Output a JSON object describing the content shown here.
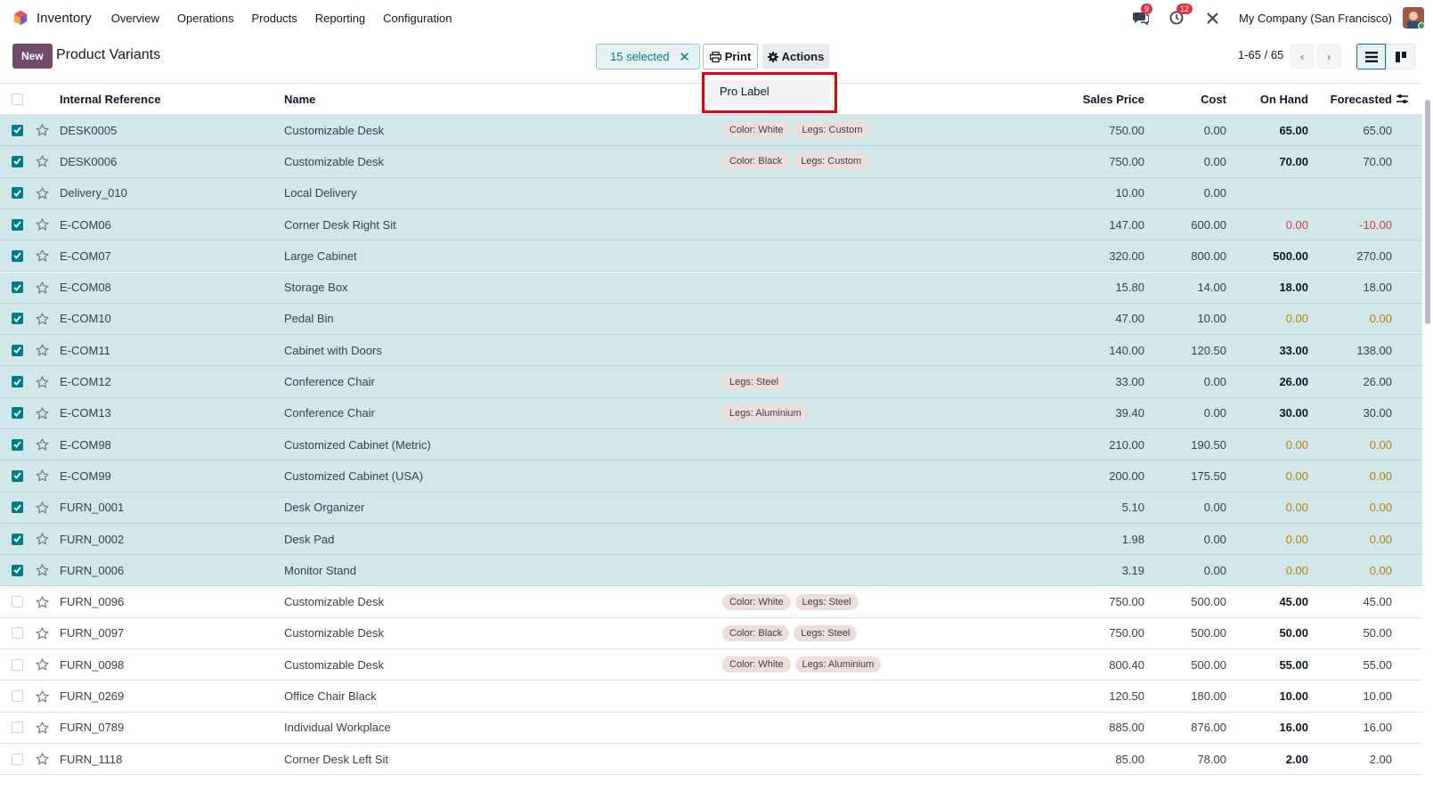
{
  "nav": {
    "app_name": "Inventory",
    "menu": [
      "Overview",
      "Operations",
      "Products",
      "Reporting",
      "Configuration"
    ],
    "messages_badge": "9",
    "activity_badge": "12",
    "company": "My Company (San Francisco)"
  },
  "control": {
    "new_label": "New",
    "title": "Product Variants",
    "selected_label": "15 selected",
    "print_label": "Print",
    "actions_label": "Actions",
    "pager": "1-65 / 65"
  },
  "dropdown": {
    "items": [
      "Pro Label"
    ]
  },
  "table": {
    "headers": {
      "reference": "Internal Reference",
      "name": "Name",
      "price": "Sales Price",
      "cost": "Cost",
      "on_hand": "On Hand",
      "forecasted": "Forecasted"
    },
    "rows": [
      {
        "ref": "DESK0005",
        "name": "Customizable Desk",
        "tags": [
          "Color: White",
          "Legs: Custom"
        ],
        "price": "750.00",
        "cost": "0.00",
        "on_hand": "65.00",
        "forecasted": "65.00",
        "selected": true,
        "status": "normal"
      },
      {
        "ref": "DESK0006",
        "name": "Customizable Desk",
        "tags": [
          "Color: Black",
          "Legs: Custom"
        ],
        "price": "750.00",
        "cost": "0.00",
        "on_hand": "70.00",
        "forecasted": "70.00",
        "selected": true,
        "status": "normal"
      },
      {
        "ref": "Delivery_010",
        "name": "Local Delivery",
        "tags": [],
        "price": "10.00",
        "cost": "0.00",
        "on_hand": "",
        "forecasted": "",
        "selected": true,
        "status": "normal"
      },
      {
        "ref": "E-COM06",
        "name": "Corner Desk Right Sit",
        "tags": [],
        "price": "147.00",
        "cost": "600.00",
        "on_hand": "0.00",
        "forecasted": "-10.00",
        "selected": true,
        "status": "negative"
      },
      {
        "ref": "E-COM07",
        "name": "Large Cabinet",
        "tags": [],
        "price": "320.00",
        "cost": "800.00",
        "on_hand": "500.00",
        "forecasted": "270.00",
        "selected": true,
        "status": "normal"
      },
      {
        "ref": "E-COM08",
        "name": "Storage Box",
        "tags": [],
        "price": "15.80",
        "cost": "14.00",
        "on_hand": "18.00",
        "forecasted": "18.00",
        "selected": true,
        "status": "normal"
      },
      {
        "ref": "E-COM10",
        "name": "Pedal Bin",
        "tags": [],
        "price": "47.00",
        "cost": "10.00",
        "on_hand": "0.00",
        "forecasted": "0.00",
        "selected": true,
        "status": "zero"
      },
      {
        "ref": "E-COM11",
        "name": "Cabinet with Doors",
        "tags": [],
        "price": "140.00",
        "cost": "120.50",
        "on_hand": "33.00",
        "forecasted": "138.00",
        "selected": true,
        "status": "normal"
      },
      {
        "ref": "E-COM12",
        "name": "Conference Chair",
        "tags": [
          "Legs: Steel"
        ],
        "price": "33.00",
        "cost": "0.00",
        "on_hand": "26.00",
        "forecasted": "26.00",
        "selected": true,
        "status": "normal"
      },
      {
        "ref": "E-COM13",
        "name": "Conference Chair",
        "tags": [
          "Legs: Aluminium"
        ],
        "price": "39.40",
        "cost": "0.00",
        "on_hand": "30.00",
        "forecasted": "30.00",
        "selected": true,
        "status": "normal"
      },
      {
        "ref": "E-COM98",
        "name": "Customized Cabinet (Metric)",
        "tags": [],
        "price": "210.00",
        "cost": "190.50",
        "on_hand": "0.00",
        "forecasted": "0.00",
        "selected": true,
        "status": "zero"
      },
      {
        "ref": "E-COM99",
        "name": "Customized Cabinet (USA)",
        "tags": [],
        "price": "200.00",
        "cost": "175.50",
        "on_hand": "0.00",
        "forecasted": "0.00",
        "selected": true,
        "status": "zero"
      },
      {
        "ref": "FURN_0001",
        "name": "Desk Organizer",
        "tags": [],
        "price": "5.10",
        "cost": "0.00",
        "on_hand": "0.00",
        "forecasted": "0.00",
        "selected": true,
        "status": "zero"
      },
      {
        "ref": "FURN_0002",
        "name": "Desk Pad",
        "tags": [],
        "price": "1.98",
        "cost": "0.00",
        "on_hand": "0.00",
        "forecasted": "0.00",
        "selected": true,
        "status": "zero"
      },
      {
        "ref": "FURN_0006",
        "name": "Monitor Stand",
        "tags": [],
        "price": "3.19",
        "cost": "0.00",
        "on_hand": "0.00",
        "forecasted": "0.00",
        "selected": true,
        "status": "zero"
      },
      {
        "ref": "FURN_0096",
        "name": "Customizable Desk",
        "tags": [
          "Color: White",
          "Legs: Steel"
        ],
        "price": "750.00",
        "cost": "500.00",
        "on_hand": "45.00",
        "forecasted": "45.00",
        "selected": false,
        "status": "normal"
      },
      {
        "ref": "FURN_0097",
        "name": "Customizable Desk",
        "tags": [
          "Color: Black",
          "Legs: Steel"
        ],
        "price": "750.00",
        "cost": "500.00",
        "on_hand": "50.00",
        "forecasted": "50.00",
        "selected": false,
        "status": "normal"
      },
      {
        "ref": "FURN_0098",
        "name": "Customizable Desk",
        "tags": [
          "Color: White",
          "Legs: Aluminium"
        ],
        "price": "800.40",
        "cost": "500.00",
        "on_hand": "55.00",
        "forecasted": "55.00",
        "selected": false,
        "status": "normal"
      },
      {
        "ref": "FURN_0269",
        "name": "Office Chair Black",
        "tags": [],
        "price": "120.50",
        "cost": "180.00",
        "on_hand": "10.00",
        "forecasted": "10.00",
        "selected": false,
        "status": "normal"
      },
      {
        "ref": "FURN_0789",
        "name": "Individual Workplace",
        "tags": [],
        "price": "885.00",
        "cost": "876.00",
        "on_hand": "16.00",
        "forecasted": "16.00",
        "selected": false,
        "status": "normal"
      },
      {
        "ref": "FURN_1118",
        "name": "Corner Desk Left Sit",
        "tags": [],
        "price": "85.00",
        "cost": "78.00",
        "on_hand": "2.00",
        "forecasted": "2.00",
        "selected": false,
        "status": "normal"
      }
    ]
  },
  "colors": {
    "brand": "#714b67",
    "accent": "#017e84",
    "selected_row": "#d1e7ea",
    "negative": "#d23f3a",
    "warning": "#b58305",
    "highlight_box": "#e3000f"
  }
}
